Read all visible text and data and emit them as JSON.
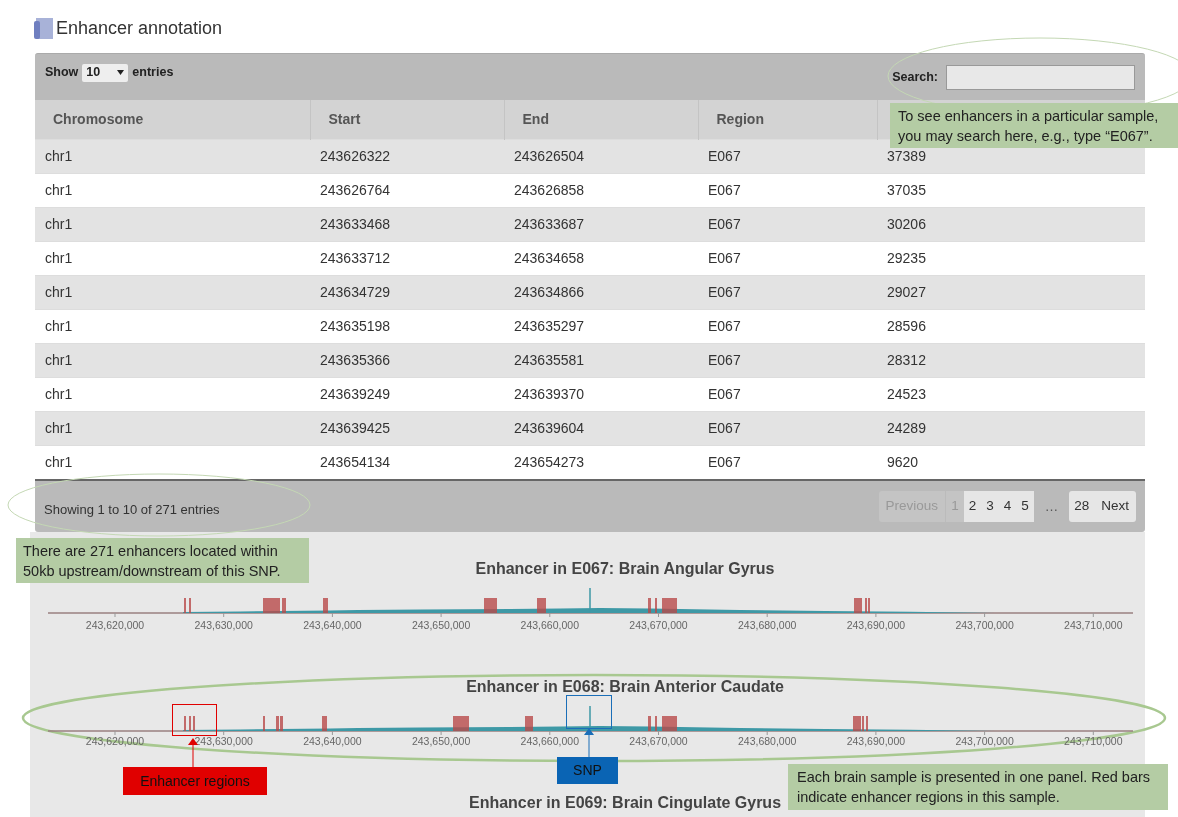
{
  "title": "Enhancer annotation",
  "length_menu": {
    "label_before": "Show",
    "value": "10",
    "label_after": "entries"
  },
  "search": {
    "label": "Search:"
  },
  "table": {
    "columns": [
      "Chromosome",
      "Start",
      "End",
      "Region"
    ],
    "rows": [
      [
        "chr1",
        "243626322",
        "243626504",
        "E067",
        "37389"
      ],
      [
        "chr1",
        "243626764",
        "243626858",
        "E067",
        "37035"
      ],
      [
        "chr1",
        "243633468",
        "243633687",
        "E067",
        "30206"
      ],
      [
        "chr1",
        "243633712",
        "243634658",
        "E067",
        "29235"
      ],
      [
        "chr1",
        "243634729",
        "243634866",
        "E067",
        "29027"
      ],
      [
        "chr1",
        "243635198",
        "243635297",
        "E067",
        "28596"
      ],
      [
        "chr1",
        "243635366",
        "243635581",
        "E067",
        "28312"
      ],
      [
        "chr1",
        "243639249",
        "243639370",
        "E067",
        "24523"
      ],
      [
        "chr1",
        "243639425",
        "243639604",
        "E067",
        "24289"
      ],
      [
        "chr1",
        "243654134",
        "243654273",
        "E067",
        "9620"
      ]
    ]
  },
  "info": "Showing 1 to 10 of 271 entries",
  "pagination": [
    {
      "kind": "prev",
      "label": "Previous",
      "disabled": true
    },
    {
      "kind": "page",
      "label": "1",
      "selected": true
    },
    {
      "kind": "page",
      "label": "2",
      "selected": false
    },
    {
      "kind": "page",
      "label": "3",
      "selected": false
    },
    {
      "kind": "page",
      "label": "4",
      "selected": false
    },
    {
      "kind": "page",
      "label": "5",
      "selected": false
    },
    {
      "kind": "ellipsis",
      "label": "…"
    },
    {
      "kind": "page",
      "label": "28",
      "selected": false
    },
    {
      "kind": "next",
      "label": "Next",
      "disabled": false
    }
  ],
  "panels": [
    {
      "title": "Enhancer in E067: Brain Angular Gyrus",
      "axis_ticks": [
        "243,620,000",
        "243,630,000",
        "243,640,000",
        "243,650,000",
        "243,660,000",
        "243,670,000",
        "243,680,000",
        "243,690,000",
        "243,700,000",
        "243,710,000"
      ]
    },
    {
      "title": "Enhancer in E068: Brain Anterior Caudate",
      "axis_ticks": [
        "243,620,000",
        "243,630,000",
        "243,640,000",
        "243,650,000",
        "243,660,000",
        "243,670,000",
        "243,680,000",
        "243,690,000",
        "243,700,000",
        "243,710,000"
      ]
    },
    {
      "title": "Enhancer in E069: Brain Cingulate Gyrus"
    }
  ],
  "annotations": [
    {
      "kind": "search_note",
      "text": "To see enhancers in a particular sample, you may search here, e.g., type “E067”."
    },
    {
      "kind": "count_note",
      "text": "There are 271 enhancers located within 50kb upstream/downstream of this SNP."
    },
    {
      "kind": "enhancer_label",
      "text": "Enhancer regions"
    },
    {
      "kind": "snp_label",
      "text": "SNP"
    },
    {
      "kind": "panel_note",
      "text": "Each brain sample is presented in one panel. Red bars indicate enhancer regions in this sample."
    }
  ]
}
